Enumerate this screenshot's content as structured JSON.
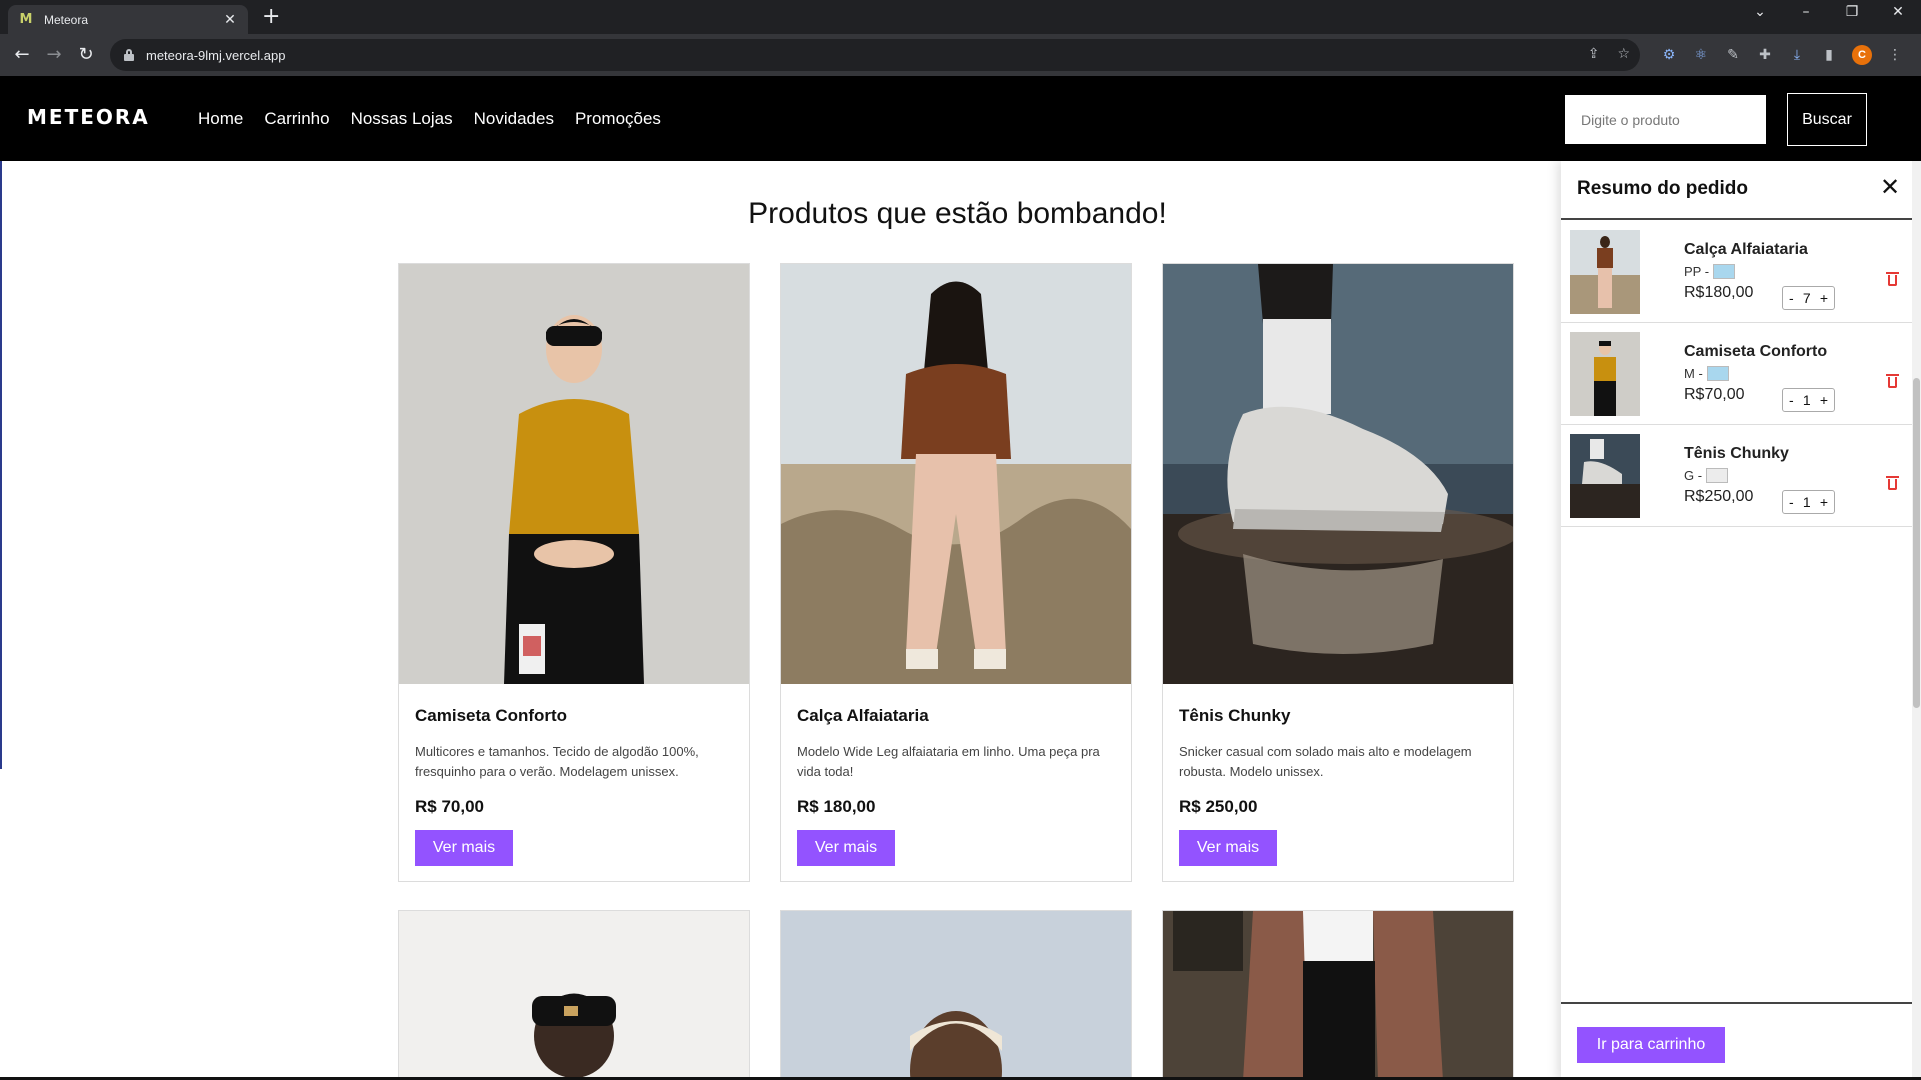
{
  "browser": {
    "tab_title": "Meteora",
    "tab_favicon": "M",
    "url": "meteora-9lmj.vercel.app",
    "avatar_letter": "C"
  },
  "site": {
    "logo": "METEORA",
    "nav": [
      "Home",
      "Carrinho",
      "Nossas Lojas",
      "Novidades",
      "Promoções"
    ],
    "search_placeholder": "Digite o produto",
    "search_button": "Buscar"
  },
  "main": {
    "section_title": "Produtos que estão bombando!",
    "products": [
      {
        "name": "Camiseta Conforto",
        "description": "Multicores e tamanhos. Tecido de algodão 100%, fresquinho para o verão. Modelagem unissex.",
        "price": "R$ 70,00",
        "button": "Ver mais"
      },
      {
        "name": "Calça Alfaiataria",
        "description": "Modelo Wide Leg alfaiataria em linho. Uma peça pra vida toda!",
        "price": "R$ 180,00",
        "button": "Ver mais"
      },
      {
        "name": "Tênis Chunky",
        "description": "Snicker casual com solado mais alto e modelagem robusta. Modelo unissex.",
        "price": "R$ 250,00",
        "button": "Ver mais"
      }
    ]
  },
  "cart": {
    "title": "Resumo do pedido",
    "items": [
      {
        "name": "Calça Alfaiataria",
        "size": "PP -",
        "color_hex": "#a9d7ee",
        "price": "R$180,00",
        "qty": "7"
      },
      {
        "name": "Camiseta Conforto",
        "size": "M -",
        "color_hex": "#a9d7ee",
        "price": "R$70,00",
        "qty": "1"
      },
      {
        "name": "Tênis Chunky",
        "size": "G -",
        "color_hex": "#ececec",
        "price": "R$250,00",
        "qty": "1"
      }
    ],
    "stepper_minus": "-",
    "stepper_plus": "+",
    "checkout_button": "Ir para carrinho"
  },
  "colors": {
    "accent": "#9353ff",
    "header_bg": "#000000",
    "delete": "#e53935"
  }
}
